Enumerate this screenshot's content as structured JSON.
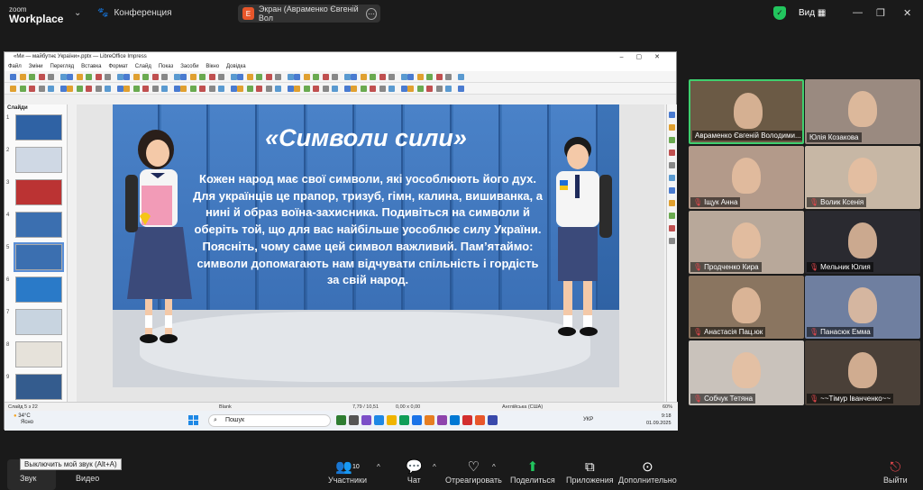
{
  "zoom": {
    "logo_small": "zoom",
    "logo_big": "Workplace",
    "meeting_label": "Конференция",
    "share_title": "Экран (Авраменко Євгеній Вол",
    "share_badge": "E",
    "view_label": "Вид"
  },
  "libreoffice": {
    "title": "«Ми — майбутнє України».pptx — LibreOffice Impress",
    "menu": [
      "Файл",
      "Зміни",
      "Перегляд",
      "Вставка",
      "Формат",
      "Слайд",
      "Показ",
      "Засоби",
      "Вікно",
      "Довідка"
    ],
    "slides_panel_title": "Слайди",
    "slide_numbers": [
      "1",
      "2",
      "3",
      "4",
      "5",
      "6",
      "7",
      "8",
      "9"
    ],
    "status": {
      "slide_count": "Слайд 5 з 22",
      "layout": "Blank",
      "position": "7,79 / 10,51",
      "size": "0,00 x 0,00",
      "language": "Англійська (США)",
      "zoom": "60%"
    }
  },
  "slide": {
    "title": "«Символи сили»",
    "body": "Кожен народ має свої символи, які уособлюють його дух. Для українців це прапор, тризуб, гімн, калина, вишиванка, а нині й образ воїна-захисника. Подивіться на символи й оберіть той, що для вас найбільше уособлює силу України. Поясніть, чому саме цей символ важливий. Пам’ятаймо: символи допомагають нам відчувати спільність і гордість за свій народ."
  },
  "taskbar": {
    "weather_temp": "34°C",
    "weather_desc": "Ясно",
    "search_placeholder": "Пошук",
    "lang": "УКР",
    "time": "9:18",
    "date": "01.09.2025"
  },
  "participants": [
    {
      "name": "Авраменко Євгеній Володими...",
      "muted": false,
      "bg": "#6b5a45"
    },
    {
      "name": "Юлія Козакова",
      "muted": false,
      "bg": "#9a8a80"
    },
    {
      "name": "Іщук Анна",
      "muted": true,
      "bg": "#b39a8a"
    },
    {
      "name": "Волик Ксенія",
      "muted": true,
      "bg": "#c7b7a5"
    },
    {
      "name": "Продченко Кира",
      "muted": true,
      "bg": "#b8a89a"
    },
    {
      "name": "Мельник Юлия",
      "muted": true,
      "bg": "#2a2a30"
    },
    {
      "name": "Анастасія Пац.юк",
      "muted": true,
      "bg": "#8a7560"
    },
    {
      "name": "Панасюк Емма",
      "muted": true,
      "bg": "#6f7fa0"
    },
    {
      "name": "Собчук Тетяна",
      "muted": true,
      "bg": "#c9c2bb"
    },
    {
      "name": "~~Тімур Іванченко~~",
      "muted": true,
      "bg": "#4a4038"
    }
  ],
  "bottom": {
    "audio": "Звук",
    "video": "Видео",
    "participants": "Участники",
    "participants_count": "10",
    "chat": "Чат",
    "react": "Отреагировать",
    "share": "Поделиться",
    "apps": "Приложения",
    "more": "Дополнительно",
    "leave": "Выйти",
    "tooltip": "Выключить мой звук (Alt+A)"
  },
  "colors": {
    "accent_green": "#22c55e",
    "active_speaker_border": "#3fcf6e",
    "slide_blue": "#3b6fb0"
  }
}
